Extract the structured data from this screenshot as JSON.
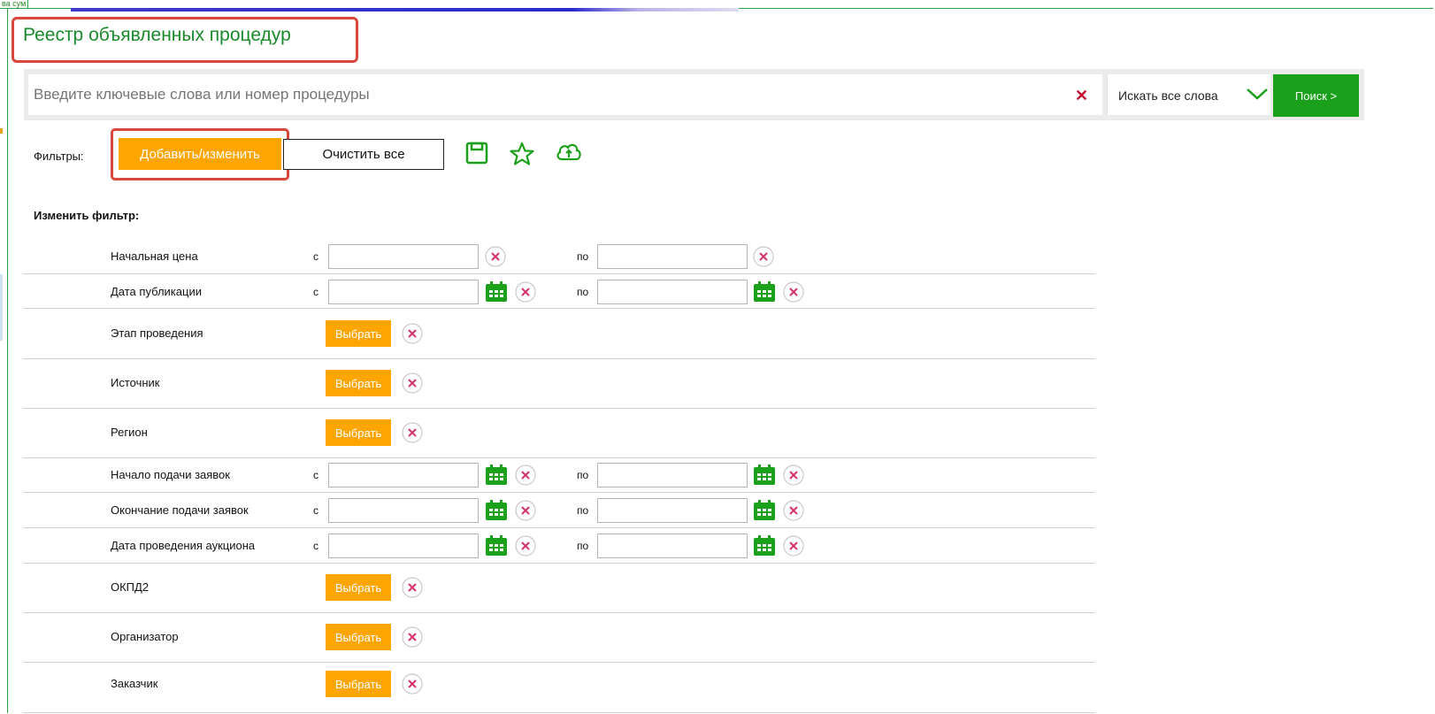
{
  "corner_label": "ва сум",
  "page": {
    "title": "Реестр объявленных процедур"
  },
  "search": {
    "placeholder": "Введите ключевые слова или номер процедуры",
    "clear_icon": "close-icon",
    "mode_label": "Искать все слова",
    "submit_label": "Поиск >"
  },
  "filters": {
    "label": "Фильтры:",
    "add_label": "Добавить/изменить",
    "clear_all_label": "Очистить все",
    "icons": [
      "save-icon",
      "star-icon",
      "cloud-upload-icon"
    ]
  },
  "edit_filter": {
    "heading": "Изменить фильтр:",
    "from_label": "с",
    "to_label": "по",
    "pick_label": "Выбрать",
    "rows": [
      {
        "label": "Начальная цена",
        "type": "range"
      },
      {
        "label": "Дата публикации",
        "type": "date-range"
      },
      {
        "label": "Этап проведения",
        "type": "pick"
      },
      {
        "label": "Источник",
        "type": "pick"
      },
      {
        "label": "Регион",
        "type": "pick"
      },
      {
        "label": "Начало подачи заявок",
        "type": "date-range"
      },
      {
        "label": "Окончание подачи заявок",
        "type": "date-range"
      },
      {
        "label": "Дата проведения аукциона",
        "type": "date-range"
      },
      {
        "label": "ОКПД2",
        "type": "pick"
      },
      {
        "label": "Организатор",
        "type": "pick"
      },
      {
        "label": "Заказчик",
        "type": "pick"
      }
    ]
  },
  "colors": {
    "accent_green": "#1aa01a",
    "accent_orange": "#ffa500",
    "highlight_red": "#d9463a",
    "clear_red": "#c8102e"
  }
}
